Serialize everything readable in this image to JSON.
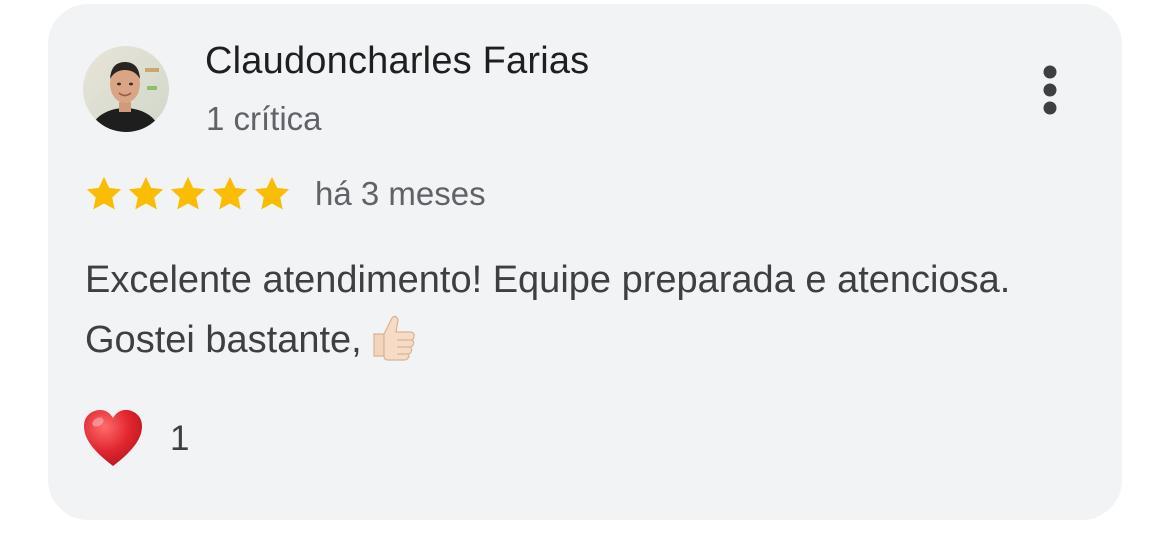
{
  "review": {
    "author": {
      "name": "Claudoncharles Farias",
      "review_count": "1 crítica",
      "avatar_icon": "person-avatar"
    },
    "rating": {
      "stars": 5,
      "max": 5,
      "star_color": "#fbbc04"
    },
    "date": "há 3 meses",
    "text": "Excelente atendimento! Equipe preparada e atenciosa. Gostei bastante,",
    "text_emoji": "thumbs-up-light-skin-emoji",
    "menu_icon": "more-vertical-icon",
    "reaction": {
      "icon": "red-heart-icon",
      "count": "1"
    }
  },
  "colors": {
    "card_background": "#f2f3f5",
    "primary_text": "#1f1f1f",
    "secondary_text": "#5f6368",
    "body_text": "#3c4043",
    "heart": "#e0262f"
  }
}
